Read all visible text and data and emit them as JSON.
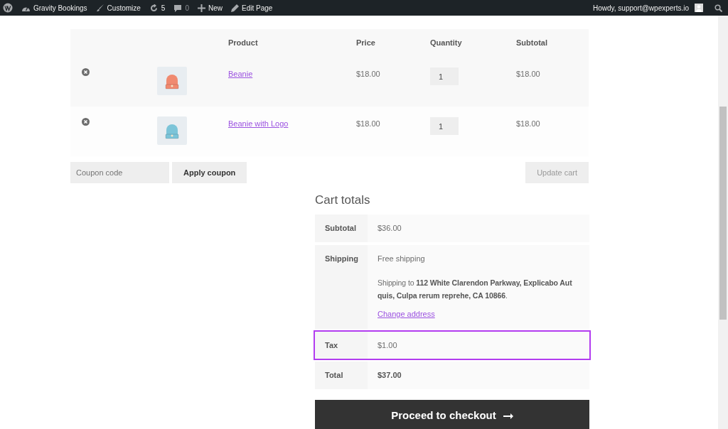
{
  "admin_bar": {
    "items": [
      {
        "kind": "wp"
      },
      {
        "kind": "site",
        "label": "Gravity Bookings"
      },
      {
        "kind": "brush",
        "label": "Customize"
      },
      {
        "kind": "updates",
        "label": "5"
      },
      {
        "kind": "comments",
        "label": "0"
      },
      {
        "kind": "plus",
        "label": "New"
      },
      {
        "kind": "pencil",
        "label": "Edit Page"
      }
    ],
    "greeting": "Howdy, support@wpexperts.io"
  },
  "cart_table": {
    "columns": [
      "Product",
      "Price",
      "Quantity",
      "Subtotal"
    ],
    "rows": [
      {
        "product": "Beanie",
        "price": "$18.00",
        "quantity": "1",
        "subtotal": "$18.00"
      },
      {
        "product": "Beanie with Logo",
        "price": "$18.00",
        "quantity": "1",
        "subtotal": "$18.00"
      }
    ]
  },
  "coupon": {
    "placeholder": "Coupon code",
    "apply_button": "Apply coupon"
  },
  "update_button": "Update cart",
  "cart_totals": {
    "title": "Cart totals",
    "rows": [
      {
        "kind": "plain",
        "label": "Subtotal",
        "value": "$36.00",
        "highlighted": false
      },
      {
        "kind": "shipping",
        "label": "Shipping",
        "value": "Free shipping",
        "note": "Shipping to **112 White Clarendon Parkway, Explicabo Aut quis, Culpa rerum reprehe, CA 10866**.",
        "link": "Change address",
        "highlighted": false
      },
      {
        "kind": "plain",
        "label": "Tax",
        "value": "$1.00",
        "highlighted": true
      },
      {
        "kind": "total",
        "label": "Total",
        "value": "$37.00",
        "highlighted": false
      }
    ],
    "checkout_button": "Proceed to checkout"
  }
}
